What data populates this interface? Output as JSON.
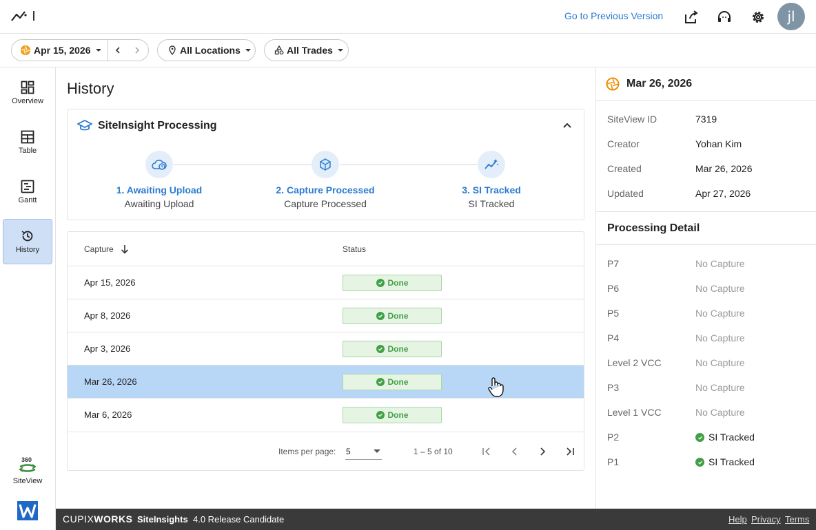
{
  "header": {
    "prev_version": "Go to Previous Version",
    "user_initials": "jl"
  },
  "filters": {
    "date": "Apr 15, 2026",
    "locations": "All Locations",
    "trades": "All Trades"
  },
  "nav": {
    "items": [
      {
        "label": "Overview"
      },
      {
        "label": "Table"
      },
      {
        "label": "Gantt"
      },
      {
        "label": "History"
      }
    ],
    "siteview": "SiteView",
    "siteview_badge": "360"
  },
  "main": {
    "title": "History",
    "processing": {
      "title": "SiteInsight Processing",
      "steps": [
        {
          "title": "1. Awaiting Upload",
          "sub": "Awaiting Upload"
        },
        {
          "title": "2. Capture Processed",
          "sub": "Capture Processed"
        },
        {
          "title": "3. SI Tracked",
          "sub": "SI Tracked"
        }
      ]
    },
    "table": {
      "col_capture": "Capture",
      "col_status": "Status",
      "rows": [
        {
          "capture": "Apr 15, 2026",
          "status": "Done"
        },
        {
          "capture": "Apr 8, 2026",
          "status": "Done"
        },
        {
          "capture": "Apr 3, 2026",
          "status": "Done"
        },
        {
          "capture": "Mar 26, 2026",
          "status": "Done"
        },
        {
          "capture": "Mar 6, 2026",
          "status": "Done"
        }
      ],
      "items_per_page_label": "Items per page:",
      "items_per_page": "5",
      "range": "1 – 5 of 10"
    }
  },
  "details": {
    "date": "Mar 26, 2026",
    "fields": [
      {
        "key": "SiteView ID",
        "value": "7319"
      },
      {
        "key": "Creator",
        "value": "Yohan Kim"
      },
      {
        "key": "Created",
        "value": "Mar 26, 2026"
      },
      {
        "key": "Updated",
        "value": "Apr 27, 2026"
      }
    ],
    "processing_title": "Processing Detail",
    "processing": [
      {
        "key": "P7",
        "value": "No Capture"
      },
      {
        "key": "P6",
        "value": "No Capture"
      },
      {
        "key": "P5",
        "value": "No Capture"
      },
      {
        "key": "P4",
        "value": "No Capture"
      },
      {
        "key": "Level 2 VCC",
        "value": "No Capture"
      },
      {
        "key": "P3",
        "value": "No Capture"
      },
      {
        "key": "Level 1 VCC",
        "value": "No Capture"
      },
      {
        "key": "P2",
        "value": "SI Tracked"
      },
      {
        "key": "P1",
        "value": "SI Tracked"
      }
    ]
  },
  "footer": {
    "brand_a": "CUPIX",
    "brand_b": "WORKS",
    "product": "SiteInsights",
    "version": "4.0 Release Candidate",
    "help": "Help",
    "privacy": "Privacy",
    "terms": "Terms"
  },
  "colors": {
    "accent": "#2b7cd0",
    "selected_row": "#b8d6f6",
    "done_green": "#43a047",
    "footer_bg": "#3a3a3a"
  }
}
